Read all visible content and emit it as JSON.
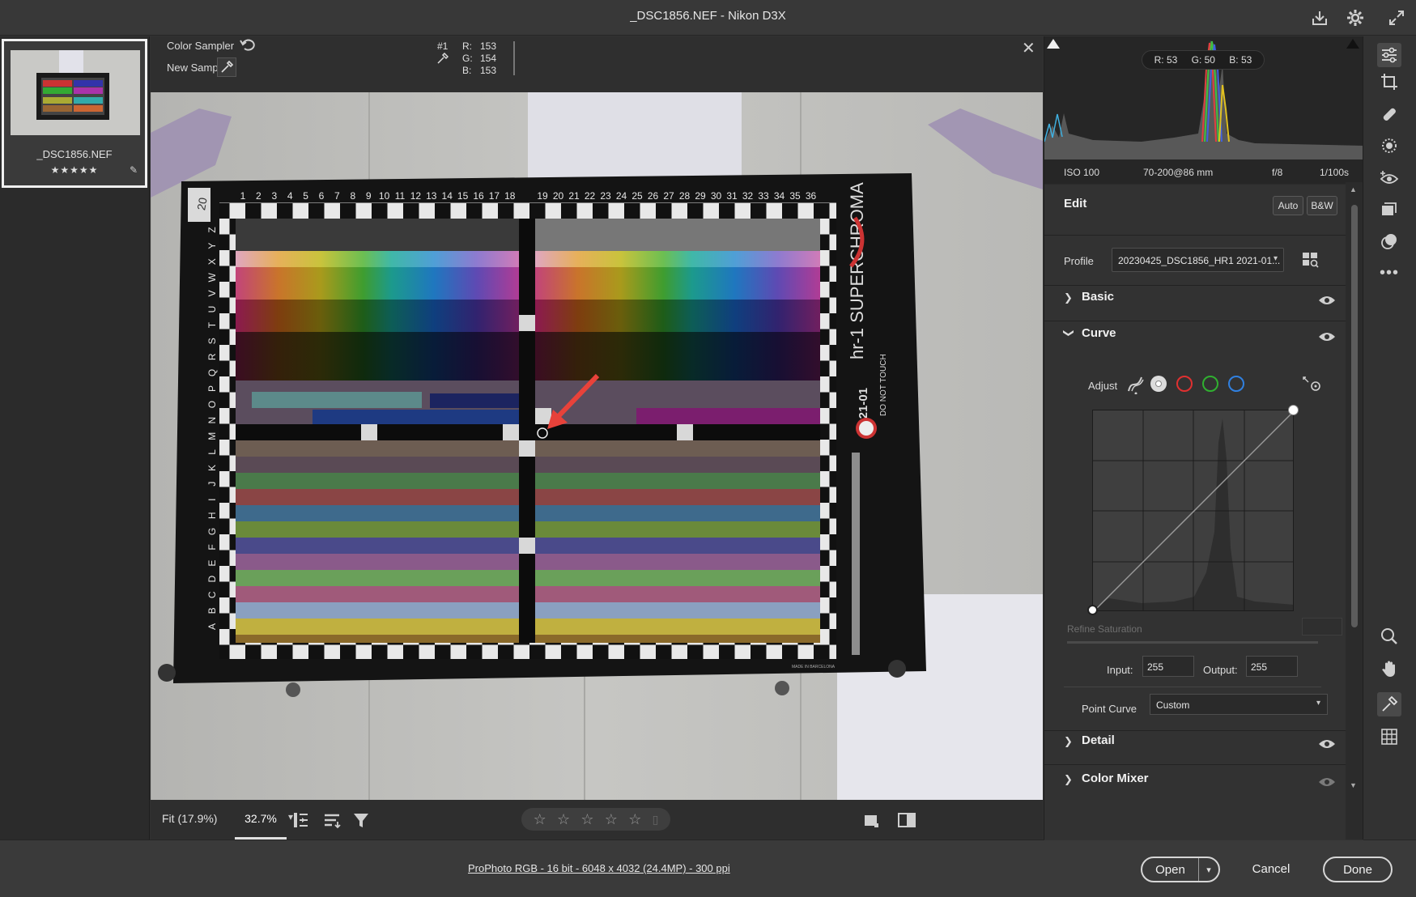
{
  "window": {
    "title": "_DSC1856.NEF  -  Nikon D3X"
  },
  "filmstrip": {
    "items": [
      {
        "name": "_DSC1856.NEF",
        "stars": "★★★★★"
      }
    ]
  },
  "sampler": {
    "label": "Color Sampler",
    "new_sample_label": "New Sample:",
    "sample_id": "#1",
    "r_label": "R:",
    "g_label": "G:",
    "b_label": "B:",
    "r": "153",
    "g": "154",
    "b": "153"
  },
  "chart": {
    "top_numbers_left": [
      "1",
      "2",
      "3",
      "4",
      "5",
      "6",
      "7",
      "8",
      "9",
      "10",
      "11",
      "12",
      "13",
      "14",
      "15",
      "16",
      "17",
      "18"
    ],
    "top_numbers_right": [
      "19",
      "20",
      "21",
      "22",
      "23",
      "24",
      "25",
      "26",
      "27",
      "28",
      "29",
      "30",
      "31",
      "32",
      "33",
      "34",
      "35",
      "36"
    ],
    "row_letters": [
      "Z",
      "Y",
      "X",
      "W",
      "V",
      "U",
      "T",
      "S",
      "R",
      "Q",
      "P",
      "O",
      "N",
      "M",
      "L",
      "K",
      "J",
      "I",
      "H",
      "G",
      "F",
      "E",
      "D",
      "C",
      "B",
      "A"
    ],
    "brand": "hr-1 SUPERCHROMA",
    "code": "2021-01",
    "warning": "DO NOT TOUCH",
    "made_in": "MADE IN BARCELONA",
    "tag": "20"
  },
  "canvas_toolbar": {
    "zoom_fit": "Fit (17.9%)",
    "zoom_pct": "32.7%"
  },
  "status": {
    "link": "ProPhoto RGB - 16 bit - 6048 x 4032 (24.4MP) - 300 ppi"
  },
  "buttons": {
    "open": "Open",
    "cancel": "Cancel",
    "done": "Done"
  },
  "histogram": {
    "r": "R: 53",
    "g": "G: 50",
    "b": "B: 53"
  },
  "meta": {
    "iso": "ISO 100",
    "lens": "70-200@86 mm",
    "aperture": "f/8",
    "shutter": "1/100s"
  },
  "edit": {
    "title": "Edit",
    "auto": "Auto",
    "bw": "B&W",
    "profile_label": "Profile",
    "profile_value": "20230425_DSC1856_HR1 2021-01...",
    "sections": {
      "basic": "Basic",
      "curve": "Curve",
      "detail": "Detail",
      "color_mixer": "Color Mixer"
    },
    "curve": {
      "adjust_label": "Adjust",
      "refine_label": "Refine Saturation",
      "input_label": "Input:",
      "input_value": "255",
      "output_label": "Output:",
      "output_value": "255",
      "point_curve_label": "Point Curve",
      "point_curve_value": "Custom"
    }
  },
  "colors": {
    "highlight_red": "#e2433b",
    "arrow_red": "#e8423a",
    "accent": "#2680eb"
  }
}
